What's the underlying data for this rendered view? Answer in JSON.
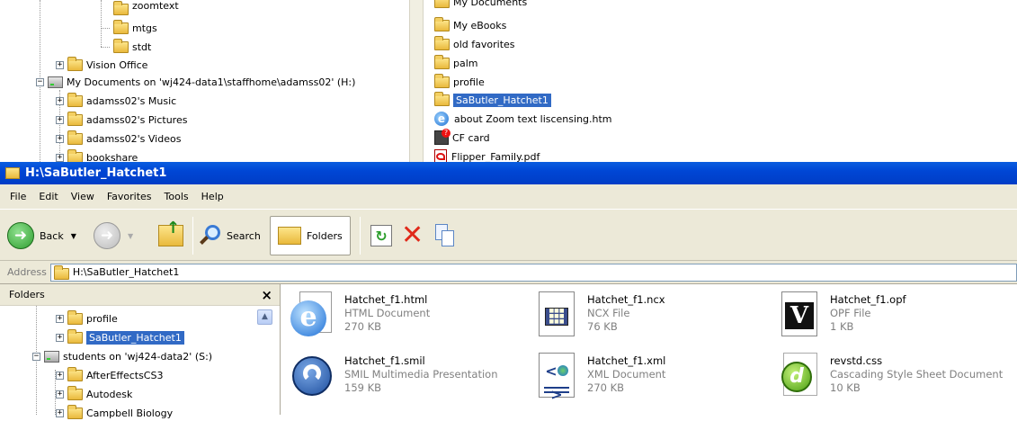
{
  "bg_left_tree": {
    "items": [
      {
        "label": "zoomtext",
        "expander": ""
      },
      {
        "label": "mtgs",
        "expander": ""
      },
      {
        "label": "stdt",
        "expander": ""
      },
      {
        "label": "Vision Office",
        "expander": "+"
      },
      {
        "label": "My Documents on 'wj424-data1\\staffhome\\adamss02' (H:)",
        "expander": "−"
      },
      {
        "label": "adamss02's Music",
        "expander": "+"
      },
      {
        "label": "adamss02's Pictures",
        "expander": "+"
      },
      {
        "label": "adamss02's Videos",
        "expander": "+"
      },
      {
        "label": "bookshare",
        "expander": "+"
      }
    ]
  },
  "bg_right_list": {
    "items": [
      "My Documents",
      "My eBooks",
      "old favorites",
      "palm",
      "profile",
      "SaButler_Hatchet1",
      "about Zoom text liscensing.htm",
      "CF card",
      "Flipper_Family.pdf"
    ]
  },
  "window": {
    "title": "H:\\SaButler_Hatchet1",
    "menu": [
      "File",
      "Edit",
      "View",
      "Favorites",
      "Tools",
      "Help"
    ],
    "toolbar": {
      "back": "Back",
      "search": "Search",
      "folders": "Folders"
    },
    "address": {
      "label": "Address",
      "value": "H:\\SaButler_Hatchet1"
    },
    "folders_pane": {
      "title": "Folders",
      "close": "×",
      "items": [
        {
          "label": "profile",
          "expander": "+"
        },
        {
          "label": "SaButler_Hatchet1",
          "expander": "+"
        },
        {
          "label": "students on 'wj424-data2' (S:)",
          "expander": "−"
        },
        {
          "label": "AfterEffectsCS3",
          "expander": "+"
        },
        {
          "label": "Autodesk",
          "expander": "+"
        },
        {
          "label": "Campbell Biology",
          "expander": "+"
        }
      ]
    },
    "files": [
      {
        "name": "Hatchet_f1.html",
        "type": "HTML Document",
        "size": "270 KB",
        "icon": "ie-html-icon"
      },
      {
        "name": "Hatchet_f1.ncx",
        "type": "NCX File",
        "size": "76 KB",
        "icon": "ncx-file-icon"
      },
      {
        "name": "Hatchet_f1.opf",
        "type": "OPF File",
        "size": "1 KB",
        "icon": "opf-file-icon"
      },
      {
        "name": "Hatchet_f1.smil",
        "type": "SMIL Multimedia Presentation",
        "size": "159 KB",
        "icon": "smil-icon"
      },
      {
        "name": "Hatchet_f1.xml",
        "type": "XML Document",
        "size": "270 KB",
        "icon": "xml-file-icon"
      },
      {
        "name": "revstd.css",
        "type": "Cascading Style Sheet Document",
        "size": "10 KB",
        "icon": "css-file-icon"
      }
    ]
  },
  "colors": {
    "selection": "#316ac5",
    "titlebar": "#0046d5",
    "chrome": "#ece9d8"
  }
}
